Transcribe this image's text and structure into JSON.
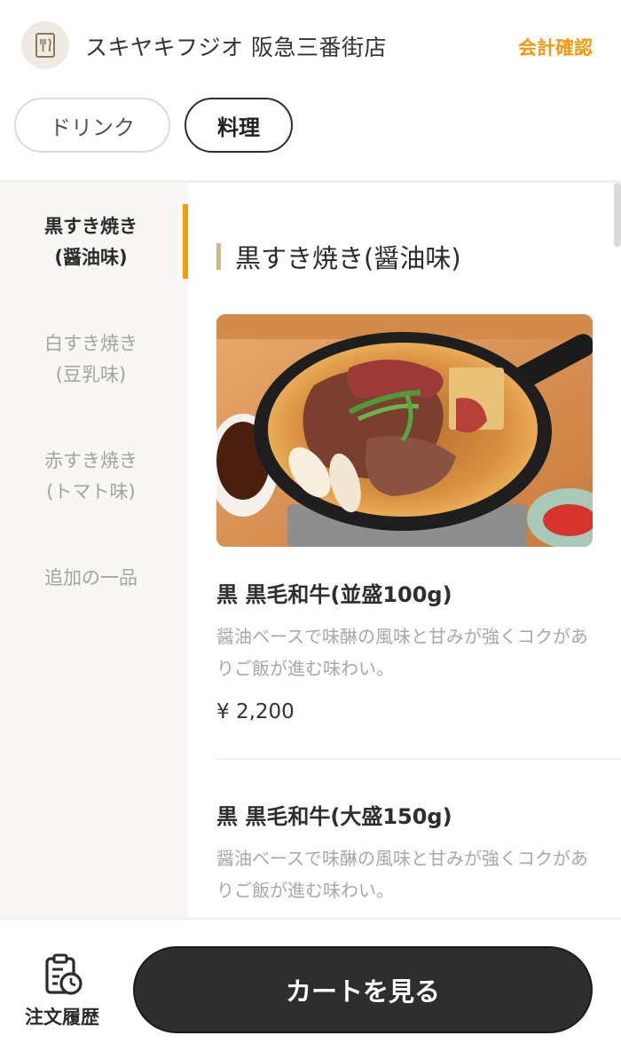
{
  "header": {
    "shop_name": "スキヤキフジオ 阪急三番街店",
    "checkout_label": "会計確認"
  },
  "tabs": [
    {
      "label": "ドリンク",
      "active": false
    },
    {
      "label": "料理",
      "active": true
    }
  ],
  "sidebar": {
    "items": [
      {
        "line1": "黒すき焼き",
        "line2": "(醤油味)",
        "active": true
      },
      {
        "line1": "白すき焼き",
        "line2": "(豆乳味)",
        "active": false
      },
      {
        "line1": "赤すき焼き",
        "line2": "(トマト味)",
        "active": false
      },
      {
        "line1": "追加の一品",
        "line2": "",
        "active": false
      }
    ]
  },
  "main": {
    "section_title": "黒すき焼き(醤油味)",
    "items": [
      {
        "name": "黒 黒毛和牛(並盛100g)",
        "description": "醤油ベースで味醂の風味と甘みが強くコクがありご飯が進む味わい。",
        "price": "¥ 2,200"
      },
      {
        "name": "黒 黒毛和牛(大盛150g)",
        "description": "醤油ベースで味醂の風味と甘みが強くコクがありご飯が進む味わい。",
        "price": ""
      }
    ]
  },
  "bottom": {
    "history_label": "注文履歴",
    "cart_label": "カートを見る"
  },
  "colors": {
    "accent": "#f39a12",
    "section_bar": "#c8b894",
    "button_dark": "#2e2e2e"
  },
  "icons": {
    "shop_logo": "restaurant-menu-icon",
    "history": "clipboard-clock-icon"
  }
}
